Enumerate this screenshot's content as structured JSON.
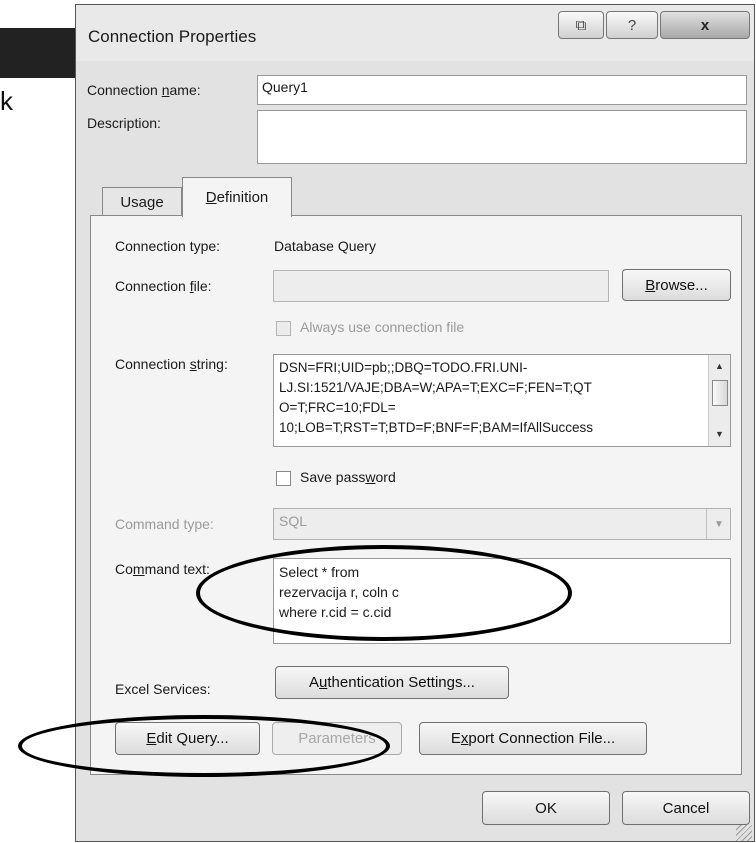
{
  "background": {
    "fragment_text": "k"
  },
  "dialog": {
    "title": "Connection Properties",
    "titlebar_buttons": {
      "restore_glyph": "⧉",
      "help": "?",
      "close": "x"
    },
    "connection_name": {
      "label_pre": "Connection ",
      "label_key": "n",
      "label_post": "ame:",
      "value": "Query1"
    },
    "description": {
      "label": "Description:",
      "value": ""
    },
    "tabs": [
      {
        "pre": "Usa",
        "key": "g",
        "post": "e"
      },
      {
        "pre": "",
        "key": "D",
        "post": "efinition"
      }
    ],
    "definition": {
      "connection_type": {
        "label": "Connection type:",
        "value": "Database Query"
      },
      "connection_file": {
        "label_pre": "Connection ",
        "label_key": "f",
        "label_post": "ile:",
        "value": ""
      },
      "browse": {
        "key": "B",
        "post": "rowse..."
      },
      "always_use": {
        "label": "Always use connection file",
        "checked": false
      },
      "connection_string": {
        "label_pre": "Connection ",
        "label_key": "s",
        "label_post": "tring:",
        "value": "DSN=FRI;UID=pb;;DBQ=TODO.FRI.UNI-\nLJ.SI:1521/VAJE;DBA=W;APA=T;EXC=F;FEN=T;QT\nO=T;FRC=10;FDL=\n10;LOB=T;RST=T;BTD=F;BNF=F;BAM=IfAllSuccess"
      },
      "save_password": {
        "pre": "Save pass",
        "key": "w",
        "post": "ord",
        "checked": false
      },
      "command_type": {
        "label": "Command type:",
        "value": "SQL"
      },
      "command_text": {
        "label_pre": "Co",
        "label_key": "m",
        "label_post": "mand text:",
        "value": "Select * from\nrezervacija r, coln c\nwhere r.cid = c.cid"
      },
      "excel_services": {
        "label": "Excel Services:"
      },
      "authentication": {
        "pre": "A",
        "key": "u",
        "post": "thentication Settings..."
      },
      "edit_query": {
        "pre": "",
        "key": "E",
        "post": "dit Query..."
      },
      "parameters": {
        "label": "Parameters"
      },
      "export": {
        "pre": "E",
        "key": "x",
        "post": "port Connection File..."
      }
    },
    "ok_label": "OK",
    "cancel_label": "Cancel"
  }
}
